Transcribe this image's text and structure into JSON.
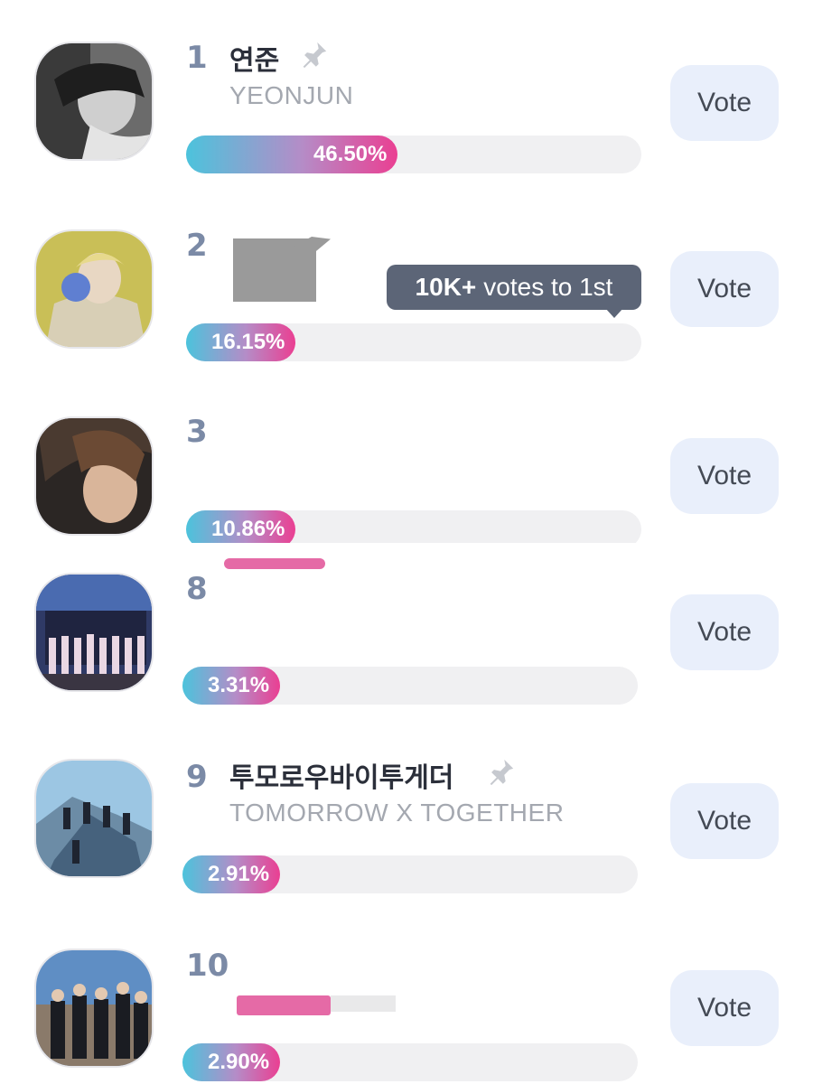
{
  "tooltip": {
    "bold": "10K+",
    "text": "votes to 1st"
  },
  "vote_label": "Vote",
  "entries": [
    {
      "rank": "1",
      "name": "연준",
      "subname": "YEONJUN",
      "percent_label": "46.50%",
      "percent": 46.5
    },
    {
      "rank": "2",
      "name": "",
      "subname": "",
      "percent_label": "16.15%",
      "percent": 16.15
    },
    {
      "rank": "3",
      "name": "",
      "subname": "",
      "percent_label": "10.86%",
      "percent": 10.86
    },
    {
      "rank": "8",
      "name": "",
      "subname": "",
      "percent_label": "3.31%",
      "percent": 3.31
    },
    {
      "rank": "9",
      "name": "투모로우바이투게더",
      "subname": "TOMORROW X TOGETHER",
      "percent_label": "2.91%",
      "percent": 2.91
    },
    {
      "rank": "10",
      "name": "",
      "subname": "",
      "percent_label": "2.90%",
      "percent": 2.9
    }
  ],
  "colors": {
    "gradient_start": "#4cc3dc",
    "gradient_end": "#ea3f92",
    "vote_button_bg": "#e9effb",
    "tooltip_bg": "#5c6577"
  },
  "icons": [
    "pin-icon"
  ]
}
